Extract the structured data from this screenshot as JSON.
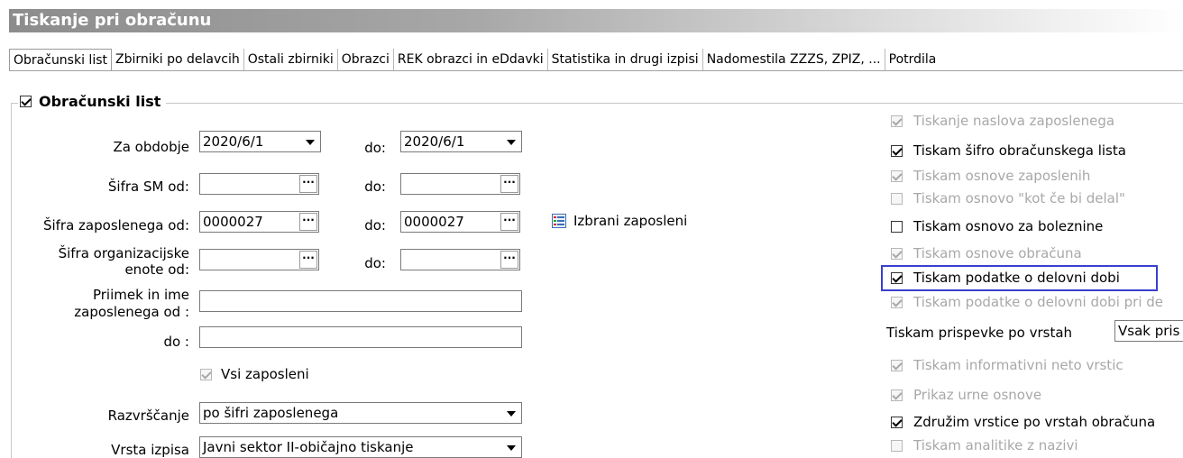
{
  "window": {
    "title": "Tiskanje pri obračunu"
  },
  "tabs": [
    "Obračunski list",
    "Zbirniki po delavcih",
    "Ostali zbirniki",
    "Obrazci",
    "REK obrazci  in eDdavki",
    "Statistika in drugi izpisi",
    "Nadomestila ZZZS, ZPIZ, ...",
    "Potrdila"
  ],
  "group": {
    "label": "Obračunski list",
    "checked": true
  },
  "form": {
    "za_obdobje": {
      "label": "Za obdobje",
      "from": "2020/6/1",
      "to_label": "do:",
      "to": "2020/6/1"
    },
    "sifra_sm": {
      "label": "Šifra SM od:",
      "from": "",
      "to_label": "do:",
      "to": ""
    },
    "sifra_zap": {
      "label": "Šifra zaposlenega od:",
      "from": "0000027",
      "to_label": "do:",
      "to": "0000027"
    },
    "sifra_org": {
      "label_1": "Šifra organizacijske",
      "label_2": "enote od:",
      "from": "",
      "to_label": "do:",
      "to": ""
    },
    "izbrani_zaposleni": "Izbrani zaposleni",
    "priimek": {
      "label_1": "Priimek in ime",
      "label_2": "zaposlenega od :",
      "value": ""
    },
    "priimek_do": {
      "label": "do :",
      "value": ""
    },
    "vsi_zaposleni": {
      "label": "Vsi zaposleni",
      "checked": true
    },
    "razvrscanje": {
      "label": "Razvrščanje",
      "value": "po šifri zaposlenega"
    },
    "vrsta_izpisa": {
      "label": "Vrsta izpisa",
      "value": "Javni sektor II-običajno tiskanje"
    }
  },
  "options": [
    {
      "label": "Tiskanje naslova zaposlenega",
      "checked": true,
      "enabled": false
    },
    {
      "label": "Tiskam šifro obračunskega lista",
      "checked": true,
      "enabled": true
    },
    {
      "label": "Tiskam osnove zaposlenih",
      "checked": true,
      "enabled": false
    },
    {
      "label": "Tiskam osnovo \"kot če bi delal\"",
      "checked": false,
      "enabled": false
    },
    {
      "label": "Tiskam osnovo za boleznine",
      "checked": false,
      "enabled": true
    },
    {
      "label": "Tiskam osnove obračuna",
      "checked": true,
      "enabled": false
    },
    {
      "label": "Tiskam podatke o delovni dobi",
      "checked": true,
      "enabled": true
    },
    {
      "label": "Tiskam podatke o delovni dobi pri de",
      "checked": true,
      "enabled": false
    }
  ],
  "prispevki": {
    "label": "Tiskam prispevke po vrstah",
    "value": "Vsak pris"
  },
  "options2": [
    {
      "label": "Tiskam informativni neto vrstic",
      "checked": true,
      "enabled": false
    },
    {
      "label": "Prikaz urne osnove",
      "checked": true,
      "enabled": false
    },
    {
      "label": "Združim vrstice po vrstah obračuna",
      "checked": true,
      "enabled": true
    },
    {
      "label": "Tiskam analitike z nazivi",
      "checked": false,
      "enabled": false
    }
  ],
  "highlight_color": "#3a3fcf"
}
